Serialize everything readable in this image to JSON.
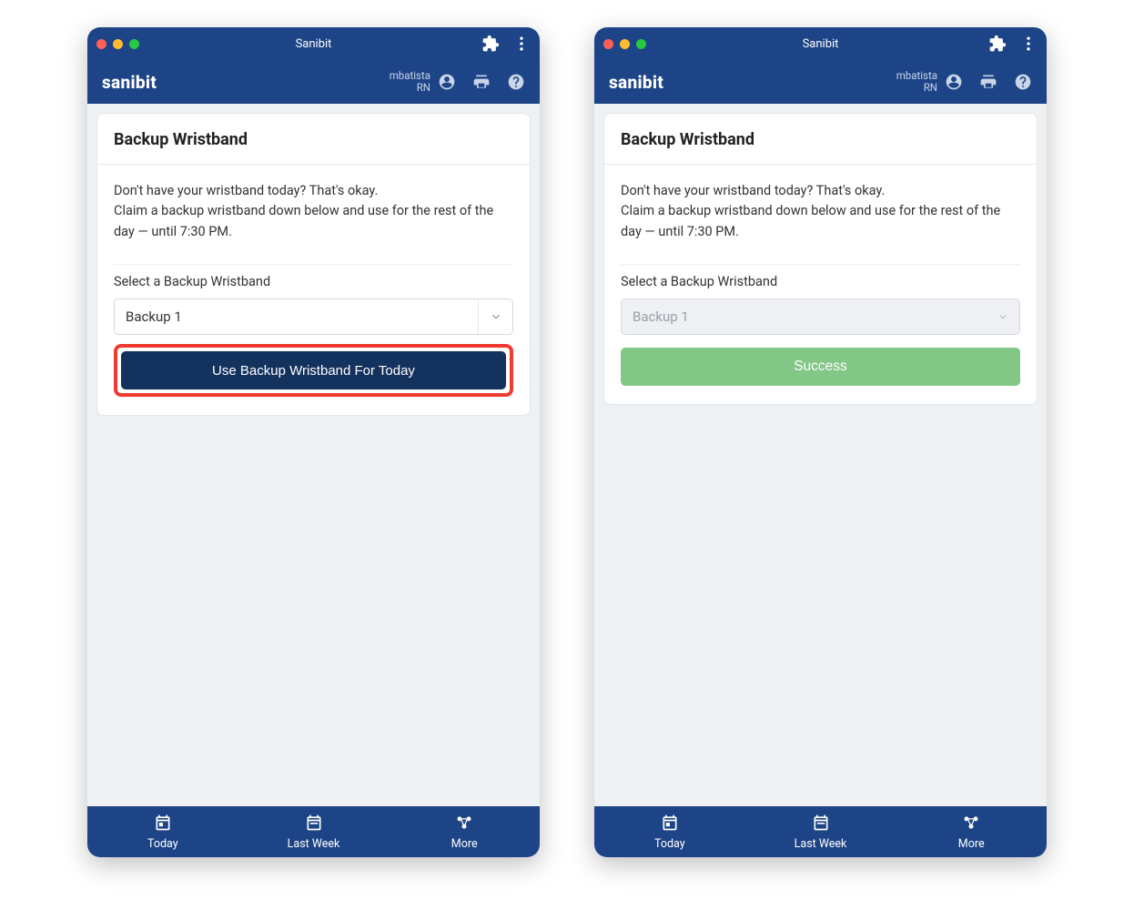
{
  "chrome": {
    "title": "Sanibit"
  },
  "header": {
    "brand": "sanibit",
    "username": "mbatista",
    "role": "RN"
  },
  "card": {
    "title": "Backup Wristband",
    "body_line1": "Don't have your wristband today? That's okay.",
    "body_line2": "Claim a backup wristband down below and use for the rest of the day — until 7:30 PM.",
    "select_label": "Select a Backup Wristband",
    "select_value": "Backup 1",
    "primary_button": "Use Backup Wristband For Today",
    "success_button": "Success"
  },
  "nav": {
    "today": "Today",
    "last_week": "Last Week",
    "more": "More"
  }
}
